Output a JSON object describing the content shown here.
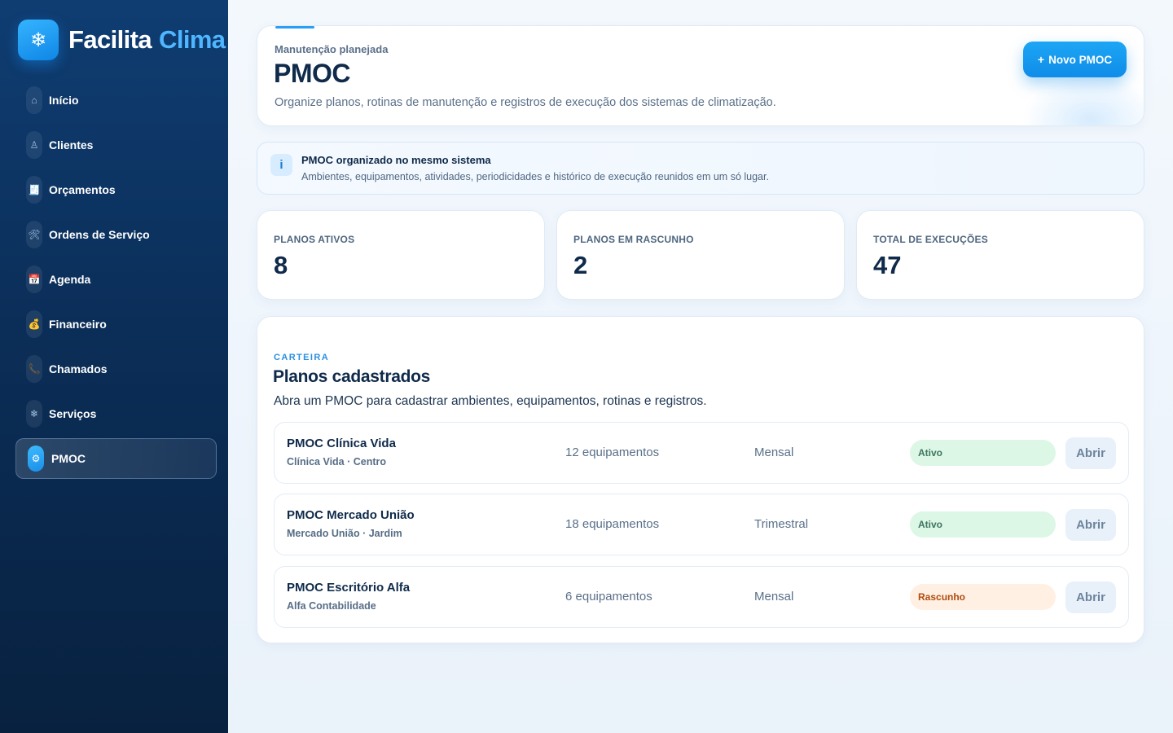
{
  "brand": {
    "logo_icon": "snowflake-icon",
    "logo_glyph": "❄",
    "name": "Facilita",
    "accent": "Clima"
  },
  "sidebar": {
    "items": [
      {
        "label": "Início",
        "icon": "home-icon",
        "glyph": "⌂",
        "active": false
      },
      {
        "label": "Clientes",
        "icon": "user-icon",
        "glyph": "♙",
        "active": false
      },
      {
        "label": "Orçamentos",
        "icon": "receipt-icon",
        "glyph": "🧾",
        "active": false
      },
      {
        "label": "Ordens de Serviço",
        "icon": "tools-icon",
        "glyph": "🛠",
        "active": false
      },
      {
        "label": "Agenda",
        "icon": "calendar-icon",
        "glyph": "📅",
        "active": false
      },
      {
        "label": "Financeiro",
        "icon": "money-bag-icon",
        "glyph": "💰",
        "active": false
      },
      {
        "label": "Chamados",
        "icon": "phone-icon",
        "glyph": "📞",
        "active": false
      },
      {
        "label": "Serviços",
        "icon": "snowflake-icon",
        "glyph": "❄",
        "active": false
      },
      {
        "label": "PMOC",
        "icon": "gear-icon",
        "glyph": "⚙",
        "active": true
      }
    ]
  },
  "header": {
    "eyebrow": "Manutenção planejada",
    "title": "PMOC",
    "description": "Organize planos, rotinas de manutenção e registros de execução dos sistemas de climatização.",
    "new_button": {
      "plus": "+",
      "label": "Novo PMOC"
    }
  },
  "info": {
    "icon_glyph": "i",
    "title": "PMOC organizado no mesmo sistema",
    "text": "Ambientes, equipamentos, atividades, periodicidades e histórico de execução reunidos em um só lugar."
  },
  "stats": [
    {
      "label": "PLANOS ATIVOS",
      "value": "8"
    },
    {
      "label": "PLANOS EM RASCUNHO",
      "value": "2"
    },
    {
      "label": "TOTAL DE EXECUÇÕES",
      "value": "47"
    }
  ],
  "plans": {
    "eyebrow": "CARTEIRA",
    "title": "Planos cadastrados",
    "description": "Abra um PMOC para cadastrar ambientes, equipamentos, rotinas e registros.",
    "rows": [
      {
        "name": "PMOC Clínica Vida",
        "client": "Clínica Vida · Centro",
        "equipment": "12 equipamentos",
        "period": "Mensal",
        "status": "Ativo",
        "status_type": "ativo",
        "action": "Abrir"
      },
      {
        "name": "PMOC Mercado União",
        "client": "Mercado União · Jardim",
        "equipment": "18 equipamentos",
        "period": "Trimestral",
        "status": "Ativo",
        "status_type": "ativo",
        "action": "Abrir"
      },
      {
        "name": "PMOC Escritório Alfa",
        "client": "Alfa Contabilidade",
        "equipment": "6 equipamentos",
        "period": "Mensal",
        "status": "Rascunho",
        "status_type": "rascunho",
        "action": "Abrir"
      }
    ]
  },
  "colors": {
    "accent": "#1da6f5",
    "sidebar": "#0b2e58",
    "active_badge": "#dcf7e6",
    "draft_badge": "#fff0e3"
  }
}
